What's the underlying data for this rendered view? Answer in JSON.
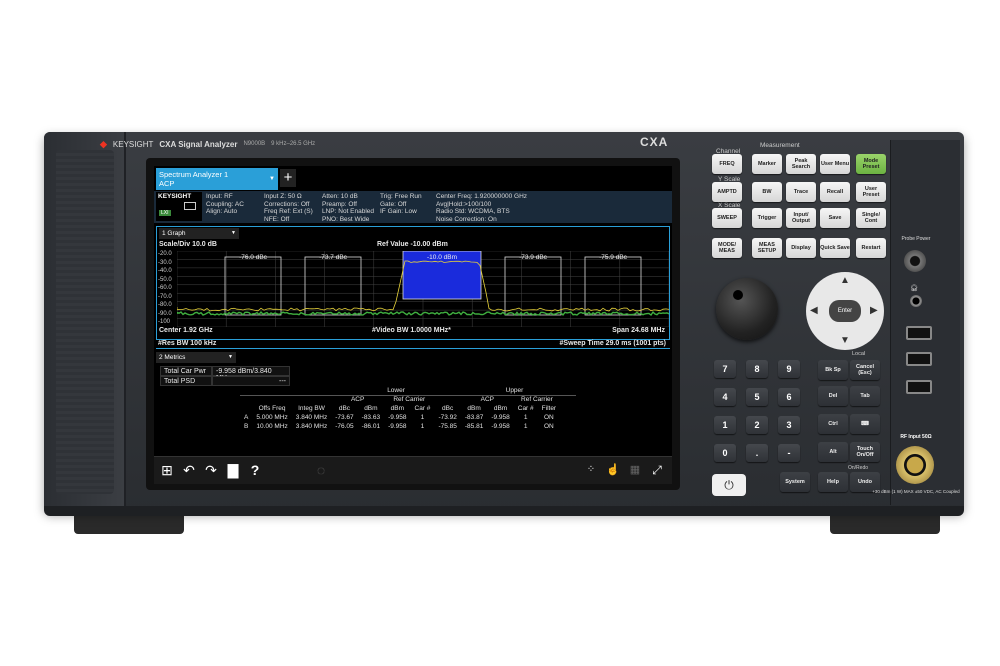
{
  "device": {
    "brand": "KEYSIGHT",
    "product": "CXA Signal Analyzer",
    "model_code": "N9000B",
    "freq_range": "9 kHz–26.5 GHz",
    "model_tag": "CXA"
  },
  "screen": {
    "tab": {
      "line1": "Spectrum Analyzer 1",
      "line2": "ACP",
      "add": "+"
    },
    "brand_box": {
      "brand": "KEYSIGHT",
      "lxi": "LXI"
    },
    "settings": {
      "col1": [
        "Input: RF",
        "Coupling: AC",
        "Align: Auto"
      ],
      "col2": [
        "Input Z: 50 Ω",
        "Corrections: Off",
        "Freq Ref: Ext (S)",
        "NFE: Off"
      ],
      "col3": [
        "Atten: 10 dB",
        "Preamp: Off",
        "LNP: Not Enabled",
        "PNO: Best Wide"
      ],
      "col4": [
        "Trig: Free Run",
        "Gate: Off",
        "IF Gain: Low"
      ],
      "col5": [
        "Center Freq: 1.920000000 GHz",
        "Avg|Hold:>100/100",
        "Radio Std: WCDMA, BTS",
        "Noise Correction: On"
      ]
    },
    "graph": {
      "dropdown": "1 Graph",
      "scale": "Scale/Div 10.0 dB",
      "ref_value": "Ref Value -10.00 dBm",
      "y_ticks": [
        "-20.0",
        "-30.0",
        "-40.0",
        "-50.0",
        "-60.0",
        "-70.0",
        "-80.0",
        "-90.0",
        "-100"
      ],
      "channel_labels": [
        "-76.0 dBc",
        "-73.7 dBc",
        "-10.0 dBm",
        "-73.9 dBc",
        "-75.9 dBc"
      ],
      "center": "Center 1.92 GHz",
      "vbw": "#Video BW 1.0000 MHz*",
      "span": "Span 24.68 MHz",
      "rbw": "#Res BW 100 kHz",
      "sweep": "#Sweep Time 29.0 ms (1001 pts)"
    },
    "metrics": {
      "dropdown": "2 Metrics",
      "total_car_pwr_label": "Total Car Pwr",
      "total_car_pwr_value": "-9.958 dBm/3.840 MHz",
      "total_psd_label": "Total PSD",
      "total_psd_value": "---",
      "table": {
        "group_headers": [
          "Lower",
          "Upper"
        ],
        "sub_headers": [
          "ACP",
          "Ref Carrier",
          "ACP",
          "Ref Carrier"
        ],
        "columns": [
          "Offs Freq",
          "Integ BW",
          "dBc",
          "dBm",
          "dBm",
          "Car #",
          "dBc",
          "dBm",
          "dBm",
          "Car #",
          "Filter"
        ],
        "rows": [
          [
            "A",
            "5.000 MHz",
            "3.840 MHz",
            "-73.67",
            "-83.63",
            "-9.958",
            "1",
            "-73.92",
            "-83.87",
            "-9.958",
            "1",
            "ON"
          ],
          [
            "B",
            "10.00 MHz",
            "3.840 MHz",
            "-76.05",
            "-86.01",
            "-9.958",
            "1",
            "-75.85",
            "-85.81",
            "-9.958",
            "1",
            "ON"
          ]
        ]
      }
    },
    "taskbar": [
      "windows-icon",
      "undo-icon",
      "redo-icon",
      "folder-icon",
      "help-icon",
      "chat-icon",
      "grid-icon",
      "touch-icon",
      "tile-icon",
      "fullscreen-icon"
    ]
  },
  "panel": {
    "measurement_title": "Measurement",
    "channel_label": "Channel",
    "yscale_label": "Y Scale",
    "xscale_label": "X Scale",
    "keys": {
      "freq": "FREQ",
      "marker": "Marker",
      "peak": "Peak Search",
      "user_menu": "User Menu",
      "mode_preset": "Mode Preset",
      "amptd": "AMPTD",
      "bw": "BW",
      "trace": "Trace",
      "recall": "Recall",
      "user_preset": "User Preset",
      "sweep": "SWEEP",
      "trigger": "Trigger",
      "input_output": "Input/ Output",
      "save": "Save",
      "single_cont": "Single/ Cont",
      "mode_meas": "MODE/ MEAS",
      "meas_setup": "MEAS SETUP",
      "display": "Display",
      "quick_save": "Quick Save",
      "restart": "Restart",
      "enter": "Enter"
    },
    "numpad": [
      "7",
      "8",
      "9",
      "4",
      "5",
      "6",
      "1",
      "2",
      "3",
      "0",
      ".",
      "-"
    ],
    "side_keys": [
      "Bk Sp",
      "Del",
      "Ctrl",
      "Alt",
      "System",
      "Help"
    ],
    "right_keys": {
      "local": "Local",
      "cancel": "Cancel (Esc)",
      "tab": "Tab",
      "touch": "Touch On/Off",
      "undo": "Undo",
      "onoff_label": "On/Redo"
    },
    "probe_power": "Probe Power",
    "rf_input": "RF Input 50Ω",
    "rf_warning": "+30 dBm (1 W) MAX ±50 VDC, AC Coupled"
  }
}
